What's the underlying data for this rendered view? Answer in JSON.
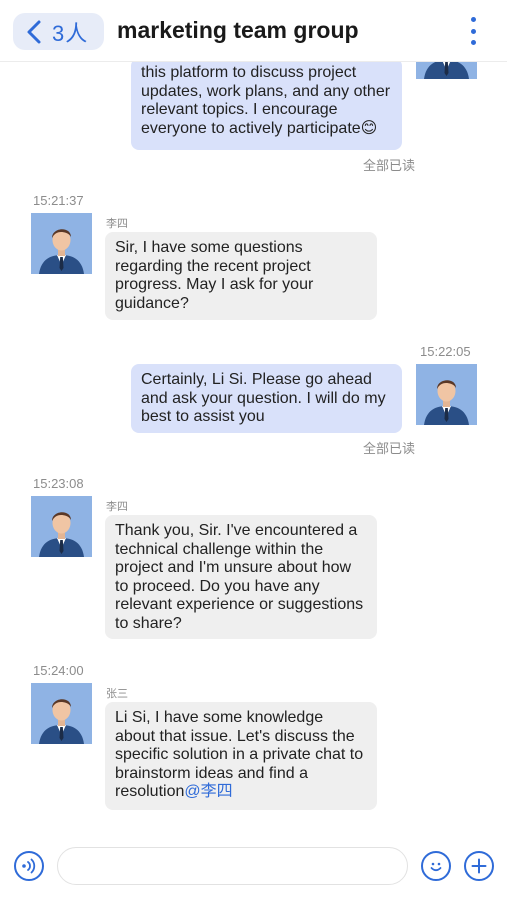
{
  "header": {
    "back_count": "3人",
    "title": "marketing team group"
  },
  "messages": [
    {
      "id": "m0",
      "text": "this platform to discuss project updates, work plans, and any other relevant topics. I encourage everyone to actively participate😊",
      "read_status": "全部已读"
    },
    {
      "id": "m1",
      "time": "15:21:37",
      "sender": "李四",
      "text": "Sir, I have some questions regarding the recent project progress. May I ask for your guidance?"
    },
    {
      "id": "m2",
      "time": "15:22:05",
      "text": "Certainly, Li Si. Please go ahead and ask your question. I will do my best to assist you",
      "read_status": "全部已读"
    },
    {
      "id": "m3",
      "time": "15:23:08",
      "sender": "李四",
      "text": "Thank you, Sir. I've encountered a technical challenge within the project and I'm unsure about how to proceed. Do you have any relevant experience or suggestions to share?"
    },
    {
      "id": "m4",
      "time": "15:24:00",
      "sender": "张三",
      "text": "Li Si, I have some knowledge about that issue. Let's discuss the specific solution in a private chat to brainstorm ideas and find a resolution",
      "mention": "@李四"
    }
  ],
  "composer": {
    "voice_icon": "voice-icon",
    "emoji_icon": "emoji-icon",
    "plus_icon": "plus-icon"
  },
  "colors": {
    "accent": "#2f6bd8",
    "my_bubble": "#d9e1fa",
    "other_bubble": "#efefef",
    "avatar_bg": "#8fb3e4"
  }
}
